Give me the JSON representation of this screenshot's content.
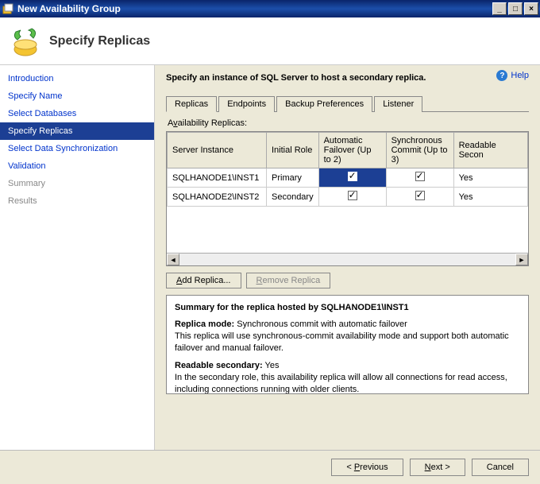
{
  "window": {
    "title": "New Availability Group"
  },
  "header": {
    "title": "Specify Replicas"
  },
  "help": {
    "label": "Help"
  },
  "nav": {
    "items": [
      "Introduction",
      "Specify Name",
      "Select Databases",
      "Specify Replicas",
      "Select Data Synchronization",
      "Validation",
      "Summary",
      "Results"
    ],
    "selected": "Specify Replicas"
  },
  "main": {
    "instruction": "Specify an instance of SQL Server to host a secondary replica.",
    "tabs": [
      "Replicas",
      "Endpoints",
      "Backup Preferences",
      "Listener"
    ],
    "active_tab": "Replicas",
    "section_label": "Availability Replicas:",
    "columns": {
      "c0": "Server Instance",
      "c1": "Initial Role",
      "c2": "Automatic Failover (Up to 2)",
      "c3": "Synchronous Commit (Up to 3)",
      "c4": "Readable Secon"
    },
    "rows": [
      {
        "server": "SQLHANODE1\\INST1",
        "role": "Primary",
        "auto": true,
        "sync": true,
        "readable": "Yes",
        "selected": true
      },
      {
        "server": "SQLHANODE2\\INST2",
        "role": "Secondary",
        "auto": true,
        "sync": true,
        "readable": "Yes",
        "selected": false
      }
    ],
    "buttons": {
      "add": "Add Replica...",
      "remove": "Remove Replica"
    },
    "summary": {
      "title": "Summary for the replica hosted by SQLHANODE1\\INST1",
      "mode_label": "Replica mode:",
      "mode_value": "Synchronous commit with automatic failover",
      "mode_desc": "This replica will use synchronous-commit availability mode and support both automatic failover and manual failover.",
      "readable_label": "Readable secondary:",
      "readable_value": "Yes",
      "readable_desc": "In the secondary role, this availability replica will allow all connections for read access, including connections running with older clients."
    }
  },
  "footer": {
    "prev": "< Previous",
    "next": "Next >",
    "cancel": "Cancel"
  }
}
